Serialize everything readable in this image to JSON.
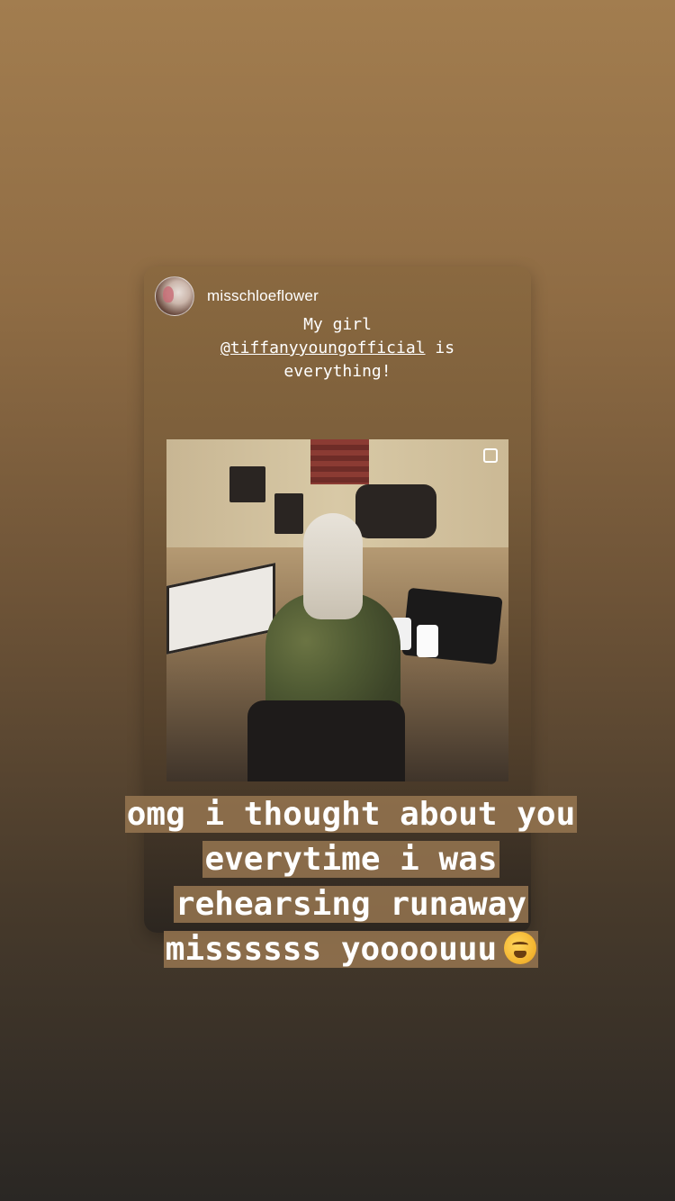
{
  "story": {
    "shared_post": {
      "username": "misschloeflower",
      "caption": {
        "prefix": "My girl",
        "mention": "@tiffanyyoungofficial",
        "mid": " is",
        "suffix": "everything!"
      },
      "photo_icon": "square-frame-icon"
    },
    "overlay_text": {
      "line1": "omg i thought about you",
      "line2": "everytime i was",
      "line3": "rehearsing runaway",
      "line4": "missssss yoooouuu",
      "emoji": "weary-face-emoji"
    },
    "colors": {
      "top": "#a27d4f",
      "bottom": "#2a2724",
      "text_bg": "#967650"
    }
  }
}
